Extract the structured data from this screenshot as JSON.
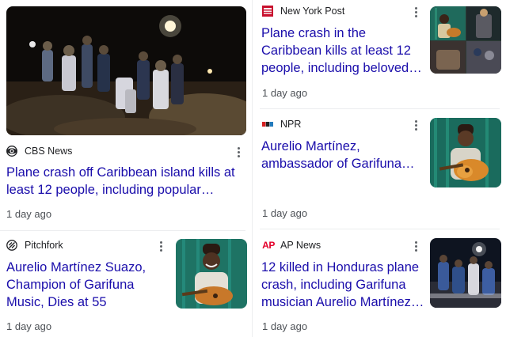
{
  "articles": [
    {
      "source": "CBS News",
      "logo": "cbs-eye-logo",
      "headline": "Plane crash off Caribbean island kills at least 12 people, including popular Hondur…",
      "age": "1 day ago",
      "image": "night-crash-scene-photo"
    },
    {
      "source": "New York Post",
      "logo": "nypost-logo",
      "headline": "Plane crash in the Caribbean kills at least 12 people, including beloved musician…",
      "age": "1 day ago",
      "image": "musician-collage-photo"
    },
    {
      "source": "NPR",
      "logo": "npr-logo",
      "headline": "Aurelio Martínez, ambassador of Garifuna music, has died",
      "age": "1 day ago",
      "image": "guitarist-photo"
    },
    {
      "source": "Pitchfork",
      "logo": "pitchfork-logo",
      "headline": "Aurelio Martínez Suazo, Champion of Garifuna Music, Dies at 55",
      "age": "1 day ago",
      "image": "guitarist-smiling-photo"
    },
    {
      "source": "AP News",
      "logo": "ap-logo",
      "headline": "12 killed in Honduras plane crash, including Garifuna musician Aurelio Martínez…",
      "age": "1 day ago",
      "image": "rescue-workers-photo"
    }
  ],
  "logo_texts": {
    "ap": "AP"
  },
  "colors": {
    "headline": "#1a0dab",
    "meta": "#4d5156",
    "divider": "#ecedef"
  }
}
